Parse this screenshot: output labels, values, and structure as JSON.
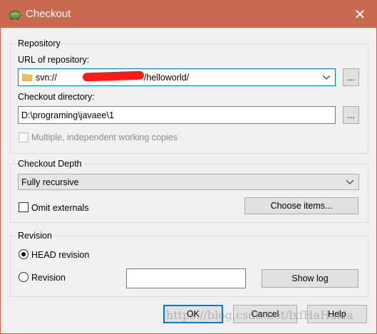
{
  "window": {
    "title": "Checkout",
    "close_glyph": "✕"
  },
  "repository": {
    "group_label": "Repository",
    "url_label": "URL of repository:",
    "url_value_prefix": "svn://",
    "url_value_suffix": "/helloworld/",
    "checkout_dir_label": "Checkout directory:",
    "checkout_dir_value": "D:\\programing\\javaee\\1",
    "browse_label": "...",
    "multiple_copies_label": "Multiple, independent working copies"
  },
  "depth": {
    "group_label": "Checkout Depth",
    "selected": "Fully recursive",
    "omit_externals_label": "Omit externals",
    "choose_items_label": "Choose items..."
  },
  "revision": {
    "group_label": "Revision",
    "head_label": "HEAD revision",
    "revision_label": "Revision",
    "revision_value": "",
    "show_log_label": "Show log"
  },
  "footer": {
    "ok_label": "OK",
    "cancel_label": "Cancel",
    "help_label": "Help"
  },
  "watermark": "https://blog.csdn.net/lxfHaHaHa"
}
